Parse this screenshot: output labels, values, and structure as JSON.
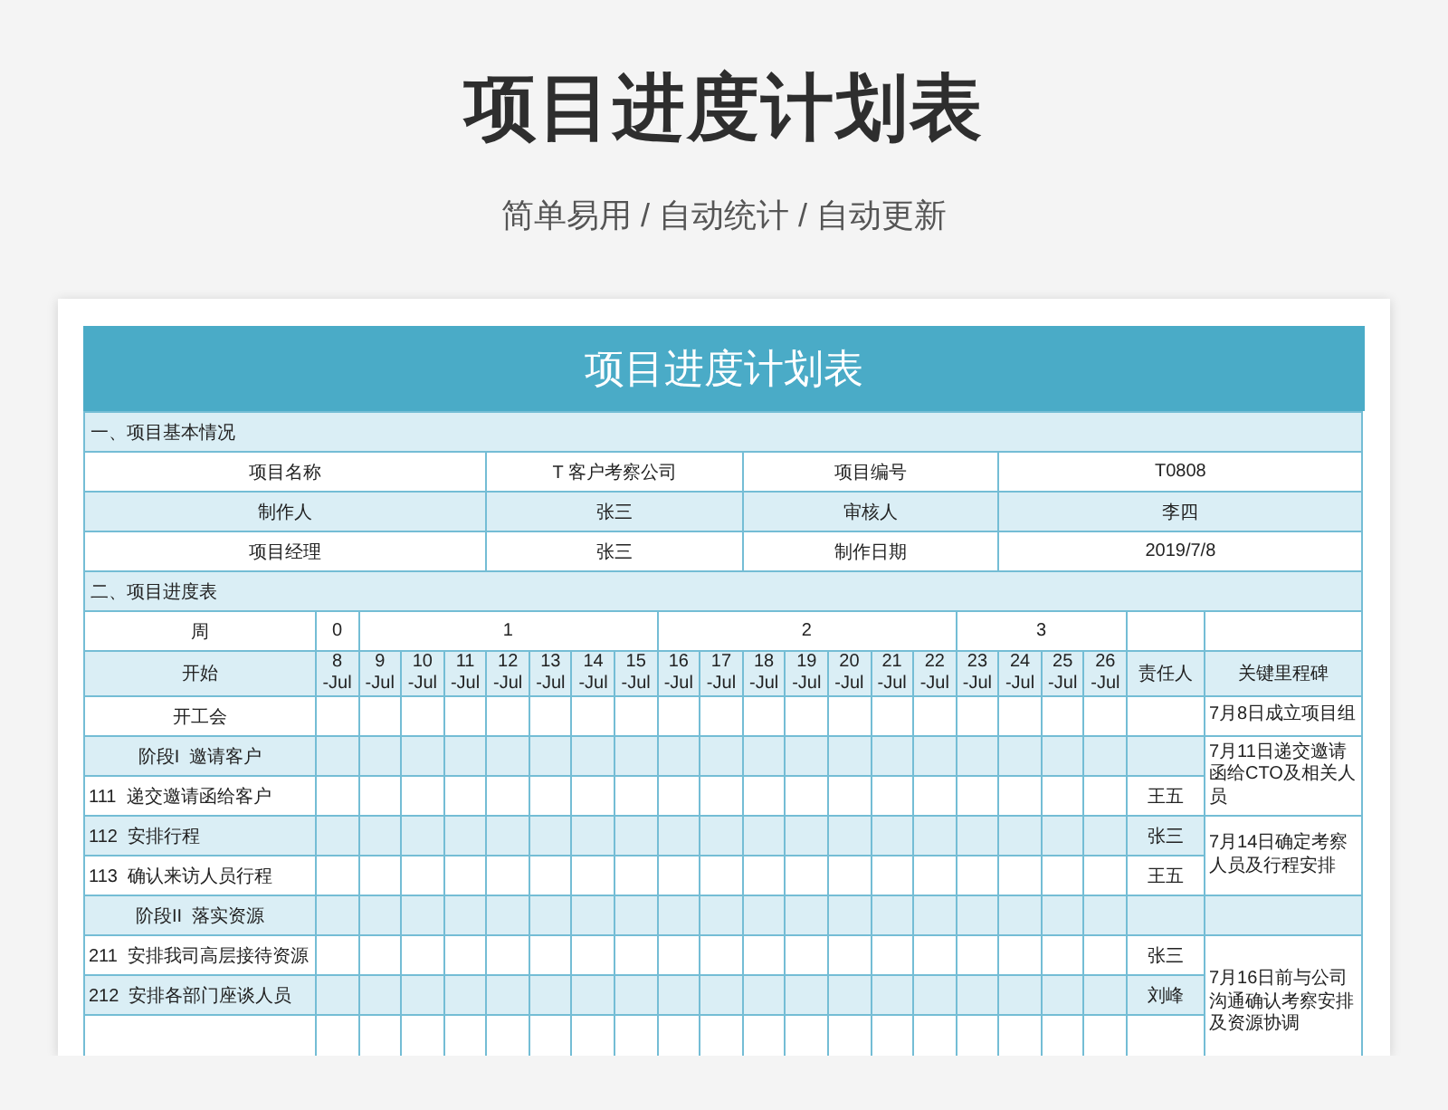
{
  "page": {
    "title": "项目进度计划表",
    "subtitle": "简单易用 / 自动统计 / 自动更新"
  },
  "sheet": {
    "title": "项目进度计划表",
    "info_section": {
      "heading": "一、项目基本情况",
      "rows": [
        {
          "label_1": "项目名称",
          "value_1": "T 客户考察公司",
          "label_2": "项目编号",
          "value_2": "T0808"
        },
        {
          "label_1": "制作人",
          "value_1": "张三",
          "label_2": "审核人",
          "value_2": "李四"
        },
        {
          "label_1": "项目经理",
          "value_1": "张三",
          "label_2": "制作日期",
          "value_2": "2019/7/8"
        }
      ]
    },
    "schedule_section": {
      "heading": "二、项目进度表",
      "week_label": "周",
      "start_label": "开始",
      "owner_header": "责任人",
      "milestone_header": "关键里程碑",
      "weeks": [
        {
          "label": "0",
          "dates": [
            "8\n-Jul"
          ]
        },
        {
          "label": "1",
          "dates": [
            "9\n-Jul",
            "10\n-Jul",
            "11\n-Jul",
            "12\n-Jul",
            "13\n-Jul",
            "14\n-Jul",
            "15\n-Jul"
          ]
        },
        {
          "label": "2",
          "dates": [
            "16\n-Jul",
            "17\n-Jul",
            "18\n-Jul",
            "19\n-Jul",
            "20\n-Jul",
            "21\n-Jul",
            "22\n-Jul"
          ]
        },
        {
          "label": "3",
          "dates": [
            "23\n-Jul",
            "24\n-Jul",
            "25\n-Jul",
            "26\n-Jul"
          ]
        }
      ],
      "groups": [
        {
          "milestone": "7月8日成立项目组",
          "tasks": [
            {
              "kind": "heading",
              "name": "开工会"
            }
          ]
        },
        {
          "milestone": "7月11日递交邀请函给CTO及相关人员",
          "tasks": [
            {
              "kind": "heading",
              "name": "阶段I  邀请客户"
            },
            {
              "kind": "task",
              "name": "111  递交邀请函给客户",
              "owner": "王五"
            }
          ]
        },
        {
          "milestone": "7月14日确定考察人员及行程安排",
          "tasks": [
            {
              "kind": "task",
              "name": "112  安排行程",
              "owner": "张三"
            },
            {
              "kind": "task",
              "name": "113  确认来访人员行程",
              "owner": "王五"
            }
          ]
        },
        {
          "tasks": [
            {
              "kind": "heading",
              "name": "阶段II  落实资源"
            }
          ]
        },
        {
          "milestone": "7月16日前与公司沟通确认考察安排及资源协调",
          "tasks": [
            {
              "kind": "task",
              "name": "211  安排我司高层接待资源",
              "owner": "张三"
            },
            {
              "kind": "task",
              "name": "212  安排各部门座谈人员",
              "owner": "刘峰"
            }
          ]
        }
      ]
    }
  }
}
